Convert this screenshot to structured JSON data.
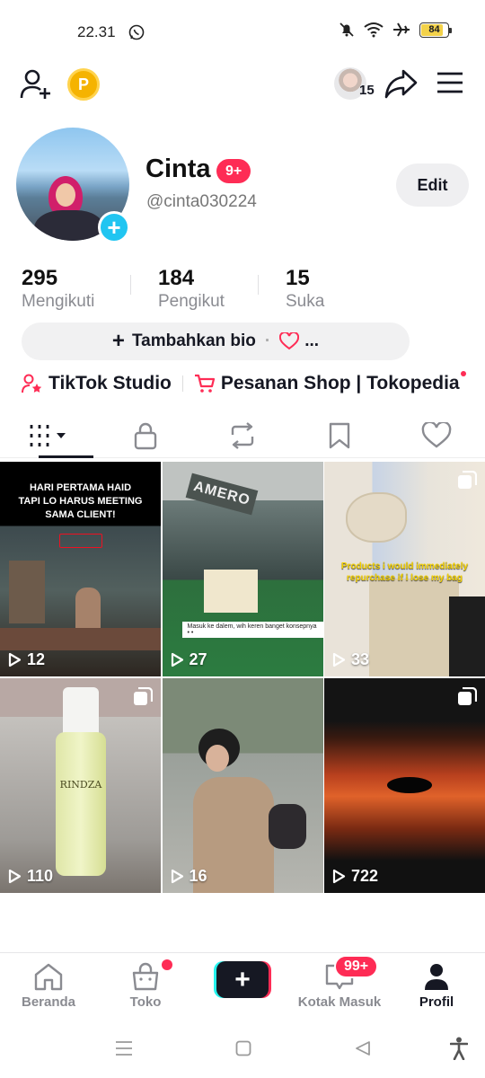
{
  "status_bar": {
    "time": "22.31",
    "battery": "84",
    "battery_level": 0.84
  },
  "header": {
    "following_avatar_count": "15"
  },
  "profile": {
    "name": "Cinta",
    "name_badge": "9+",
    "handle": "@cinta030224",
    "edit_label": "Edit",
    "stats": [
      {
        "value": "295",
        "label": "Mengikuti"
      },
      {
        "value": "184",
        "label": "Pengikut"
      },
      {
        "value": "15",
        "label": "Suka"
      }
    ],
    "bio_button_label": "Tambahkan bio",
    "bio_more": "...",
    "links": {
      "studio": "TikTok Studio",
      "shop": "Pesanan Shop | Tokopedia"
    }
  },
  "videos": [
    {
      "views": "12",
      "caption": "HARI PERTAMA HAID TAPI LO HARUS MEETING SAMA CLIENT!"
    },
    {
      "views": "27",
      "caption": "Masuk ke dalem, wih keren banget konsepnya • •",
      "sign": "AMERO"
    },
    {
      "views": "33",
      "caption": "Products i would immediately repurchase if i lose my bag",
      "multi": true
    },
    {
      "views": "110",
      "caption": "RINDZA",
      "multi": true
    },
    {
      "views": "16",
      "caption": ""
    },
    {
      "views": "722",
      "caption": "",
      "multi": true
    }
  ],
  "bottom_nav": {
    "home": "Beranda",
    "shop": "Toko",
    "inbox": "Kotak Masuk",
    "inbox_badge": "99+",
    "profile": "Profil"
  },
  "colors": {
    "accent": "#fe2c55",
    "cyan": "#25f4ee",
    "text": "#161823",
    "muted": "#8a8b91"
  }
}
